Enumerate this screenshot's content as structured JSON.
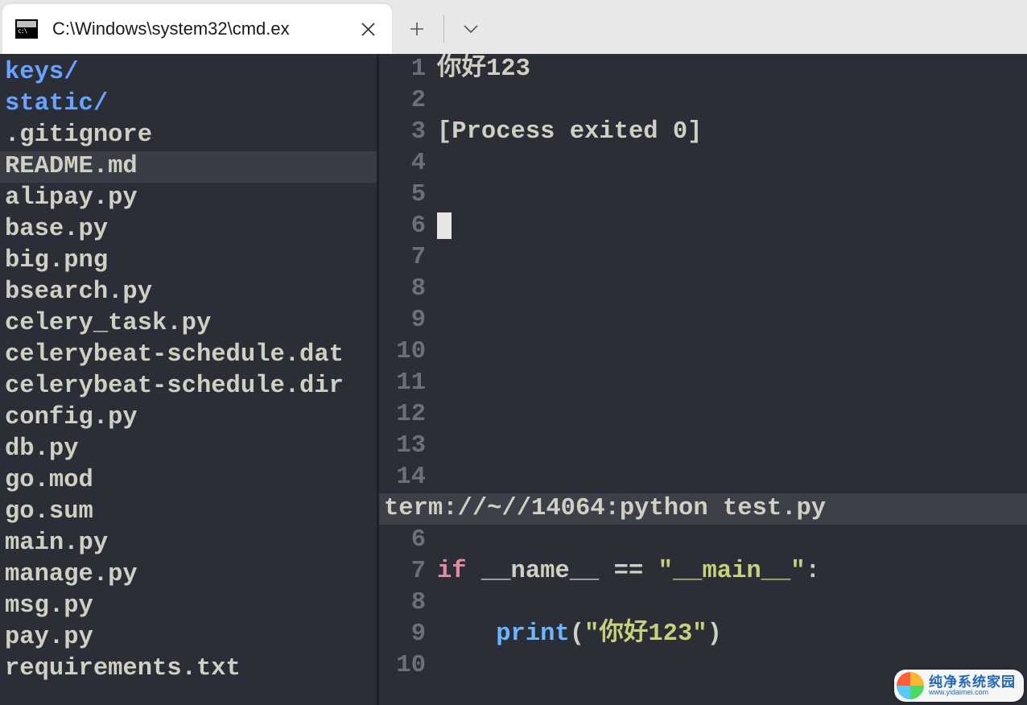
{
  "tab": {
    "title": "C:\\Windows\\system32\\cmd.ex"
  },
  "sidebar": {
    "items": [
      {
        "name": "keys/",
        "type": "dir"
      },
      {
        "name": "static/",
        "type": "dir"
      },
      {
        "name": ".gitignore",
        "type": "file"
      },
      {
        "name": "README.md",
        "type": "file",
        "selected": true
      },
      {
        "name": "alipay.py",
        "type": "file"
      },
      {
        "name": "base.py",
        "type": "file"
      },
      {
        "name": "big.png",
        "type": "file"
      },
      {
        "name": "bsearch.py",
        "type": "file"
      },
      {
        "name": "celery_task.py",
        "type": "file"
      },
      {
        "name": "celerybeat-schedule.dat",
        "type": "file"
      },
      {
        "name": "celerybeat-schedule.dir",
        "type": "file"
      },
      {
        "name": "config.py",
        "type": "file"
      },
      {
        "name": "db.py",
        "type": "file"
      },
      {
        "name": "go.mod",
        "type": "file"
      },
      {
        "name": "go.sum",
        "type": "file"
      },
      {
        "name": "main.py",
        "type": "file"
      },
      {
        "name": "manage.py",
        "type": "file"
      },
      {
        "name": "msg.py",
        "type": "file"
      },
      {
        "name": "pay.py",
        "type": "file"
      },
      {
        "name": "requirements.txt",
        "type": "file"
      }
    ]
  },
  "terminal": {
    "lines": [
      {
        "n": 1,
        "text": "你好123"
      },
      {
        "n": 2,
        "text": ""
      },
      {
        "n": 3,
        "text": "[Process exited 0]"
      },
      {
        "n": 4,
        "text": ""
      },
      {
        "n": 5,
        "text": ""
      },
      {
        "n": 6,
        "text": "",
        "cursor": true
      },
      {
        "n": 7,
        "text": ""
      },
      {
        "n": 8,
        "text": ""
      },
      {
        "n": 9,
        "text": ""
      },
      {
        "n": 10,
        "text": ""
      },
      {
        "n": 11,
        "text": ""
      },
      {
        "n": 12,
        "text": ""
      },
      {
        "n": 13,
        "text": ""
      },
      {
        "n": 14,
        "text": ""
      }
    ],
    "status": "term://~//14064:python test.py"
  },
  "code": {
    "lines": [
      {
        "n": 6,
        "tokens": []
      },
      {
        "n": 7,
        "tokens": [
          {
            "t": "if",
            "c": "kw"
          },
          {
            "t": " __name__ == ",
            "c": ""
          },
          {
            "t": "\"__main__\"",
            "c": "str"
          },
          {
            "t": ":",
            "c": ""
          }
        ]
      },
      {
        "n": 8,
        "tokens": []
      },
      {
        "n": 9,
        "tokens": [
          {
            "t": "    ",
            "c": ""
          },
          {
            "t": "print",
            "c": "fn"
          },
          {
            "t": "(",
            "c": ""
          },
          {
            "t": "\"你好123\"",
            "c": "str"
          },
          {
            "t": ")",
            "c": ""
          }
        ]
      },
      {
        "n": 10,
        "tokens": []
      }
    ]
  },
  "watermark": {
    "top": "纯净系统家园",
    "bot": "www.yidaimei.com"
  }
}
